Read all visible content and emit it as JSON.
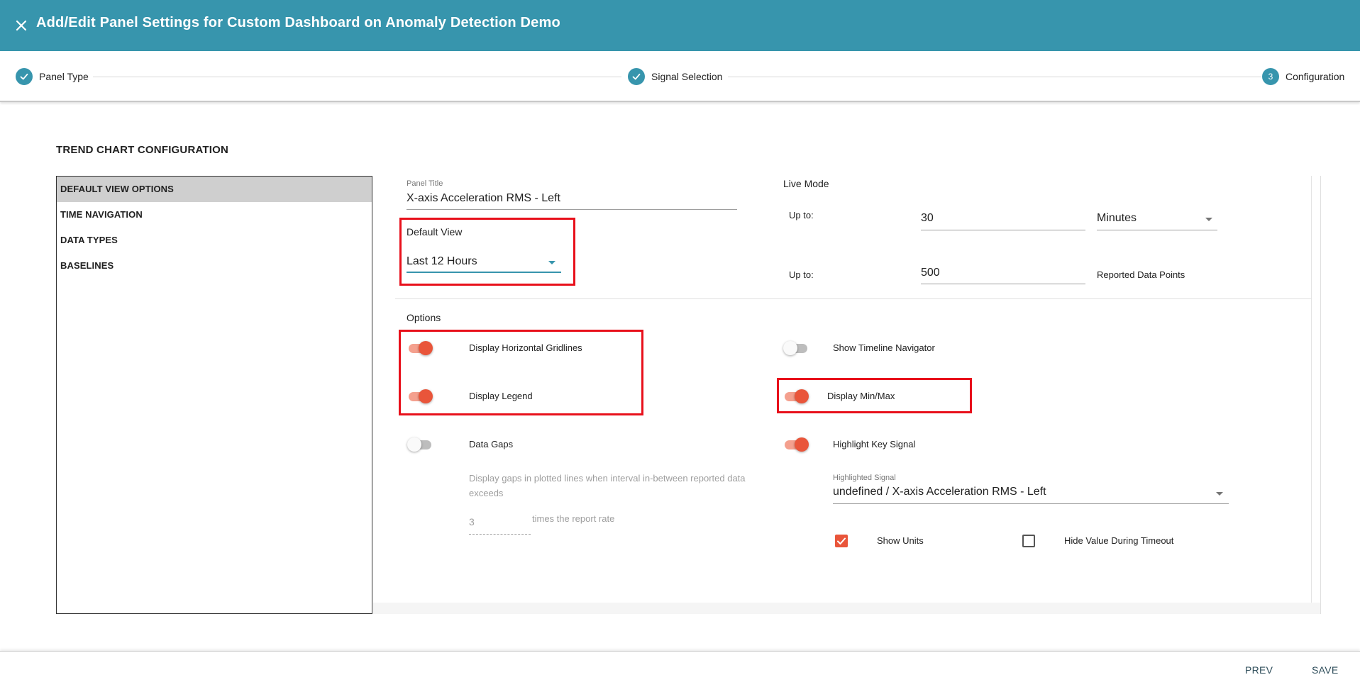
{
  "header": {
    "title": "Add/Edit Panel Settings for Custom Dashboard on Anomaly Detection Demo",
    "close_icon": "close-icon",
    "background_color": "#3795ad"
  },
  "stepper": {
    "steps": [
      {
        "label": "Panel Type",
        "state": "completed",
        "marker": "✓"
      },
      {
        "label": "Signal Selection",
        "state": "completed",
        "marker": "✓"
      },
      {
        "label": "Configuration",
        "state": "active",
        "marker": "3"
      }
    ]
  },
  "section_title": "TREND CHART CONFIGURATION",
  "nav": {
    "items": [
      {
        "label": "DEFAULT VIEW OPTIONS",
        "active": true
      },
      {
        "label": "TIME NAVIGATION",
        "active": false
      },
      {
        "label": "DATA TYPES",
        "active": false
      },
      {
        "label": "BASELINES",
        "active": false
      }
    ]
  },
  "form": {
    "panel_title": {
      "label": "Panel Title",
      "value": "X-axis Acceleration RMS - Left"
    },
    "default_view": {
      "label": "Default View",
      "value": "Last 12 Hours"
    },
    "live_mode": {
      "label": "Live Mode",
      "time": {
        "prefix": "Up to:",
        "value": "30",
        "unit": "Minutes"
      },
      "points": {
        "prefix": "Up to:",
        "value": "500",
        "unit": "Reported Data Points"
      }
    },
    "options_label": "Options",
    "options": {
      "horizontal_gridlines": {
        "label": "Display Horizontal Gridlines",
        "on": true
      },
      "legend": {
        "label": "Display Legend",
        "on": true
      },
      "data_gaps": {
        "label": "Data Gaps",
        "on": false
      },
      "timeline_navigator": {
        "label": "Show Timeline Navigator",
        "on": false
      },
      "min_max": {
        "label": "Display Min/Max",
        "on": true
      },
      "highlight_key_signal": {
        "label": "Highlight Key Signal",
        "on": true
      }
    },
    "data_gaps_help": "Display gaps in plotted lines when interval in-between reported data exceeds",
    "data_gaps_multiplier": {
      "value": "3",
      "suffix": "times the report rate"
    },
    "highlighted_signal": {
      "label": "Highlighted Signal",
      "value": "undefined / X-axis Acceleration RMS - Left"
    },
    "show_units": {
      "label": "Show Units",
      "checked": true
    },
    "hide_value_during_timeout": {
      "label": "Hide Value During Timeout",
      "checked": false
    }
  },
  "footer": {
    "prev_label": "PREV",
    "save_label": "SAVE"
  },
  "colors": {
    "accent": "#3795ad",
    "toggle_on": "#e9553a",
    "highlight_box": "#e8101b"
  }
}
